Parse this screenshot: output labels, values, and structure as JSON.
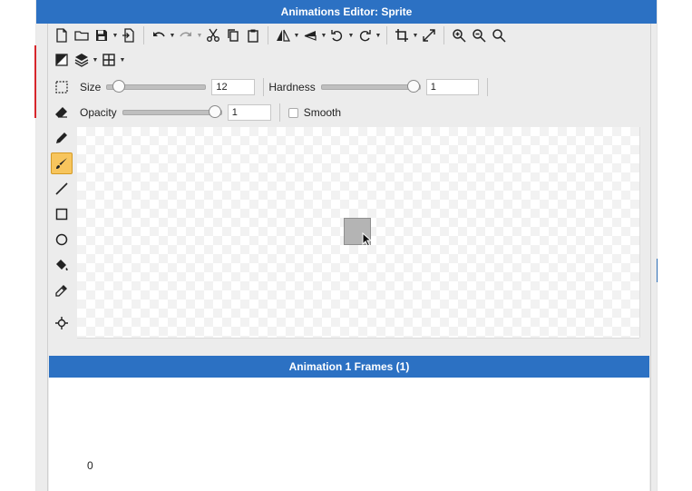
{
  "window": {
    "title": "Animations Editor: Sprite"
  },
  "toolbar": {
    "row1": [
      {
        "icon": "new-file-icon"
      },
      {
        "icon": "open-folder-icon"
      },
      {
        "icon": "save-icon"
      },
      {
        "icon": "import-icon"
      },
      {
        "icon": "undo-icon"
      },
      {
        "icon": "redo-icon"
      },
      {
        "icon": "cut-icon"
      },
      {
        "icon": "copy-icon"
      },
      {
        "icon": "paste-icon"
      },
      {
        "icon": "flip-horizontal-icon"
      },
      {
        "icon": "flip-vertical-icon"
      },
      {
        "icon": "rotate-left-icon"
      },
      {
        "icon": "rotate-right-icon"
      },
      {
        "icon": "crop-icon"
      },
      {
        "icon": "resize-icon"
      },
      {
        "icon": "zoom-in-icon"
      },
      {
        "icon": "zoom-out-icon"
      },
      {
        "icon": "zoom-fit-icon"
      }
    ],
    "row2": [
      {
        "icon": "color-swatch-icon"
      },
      {
        "icon": "layers-icon"
      },
      {
        "icon": "grid-icon"
      }
    ]
  },
  "brush": {
    "size_label": "Size",
    "size_value": "12",
    "size_fraction": 0.06,
    "hardness_label": "Hardness",
    "hardness_value": "1",
    "hardness_fraction": 1.0,
    "opacity_label": "Opacity",
    "opacity_value": "1",
    "opacity_fraction": 1.0,
    "smooth_label": "Smooth",
    "smooth_checked": false
  },
  "tools": [
    {
      "icon": "selection-icon",
      "active": false
    },
    {
      "icon": "eraser-icon",
      "active": false
    },
    {
      "icon": "pencil-icon",
      "active": false
    },
    {
      "icon": "brush-icon",
      "active": true
    },
    {
      "icon": "line-icon",
      "active": false
    },
    {
      "icon": "rectangle-icon",
      "active": false
    },
    {
      "icon": "ellipse-icon",
      "active": false
    },
    {
      "icon": "paint-bucket-icon",
      "active": false
    },
    {
      "icon": "eyedropper-icon",
      "active": false
    },
    {
      "icon": "origin-point-icon",
      "active": false
    }
  ],
  "frames": {
    "header": "Animation 1 Frames (1)",
    "items": [
      {
        "label": "0"
      }
    ]
  },
  "colors": {
    "titlebar": "#2c71c3",
    "active_tool": "#f7c55d",
    "sprite_fill": "#b4b4b4"
  }
}
